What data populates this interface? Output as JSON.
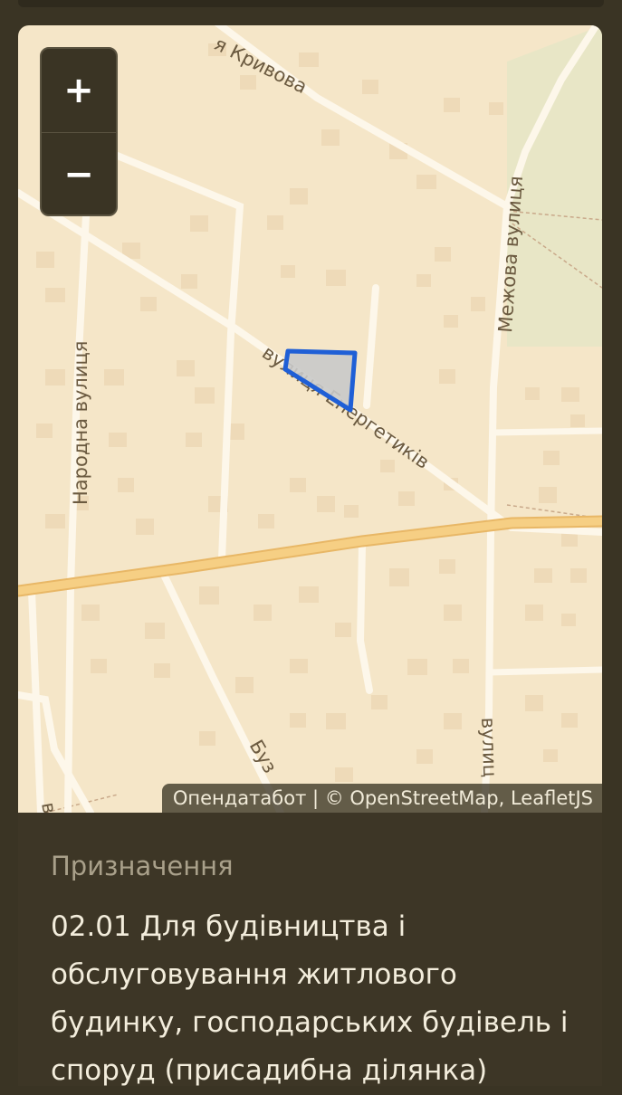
{
  "map": {
    "zoom_in_label": "+",
    "zoom_out_label": "−",
    "attribution": "Опендатабот | © OpenStreetMap, LeafletJS",
    "streets": {
      "kryvova": "я Кривова",
      "mezhova": "Межова вулиця",
      "narodna": "Народна вулиця",
      "enerhetykiv": "вулиця Енергетиків",
      "buz": "Буз",
      "vulyts": "вулиц",
      "v": "в"
    },
    "colors": {
      "background": "#f5e6c8",
      "park": "#e8e6c6",
      "road": "#fdf7ea",
      "main_road": "#f6cf84",
      "building": "#eedab8",
      "parcel_fill": "#c9c9c9",
      "parcel_stroke": "#1f5fd6"
    }
  },
  "info": {
    "label": "Призначення",
    "value": "02.01 Для будівництва і обслуговування житлового будинку, господарських будівель і споруд (присадибна ділянка)"
  }
}
